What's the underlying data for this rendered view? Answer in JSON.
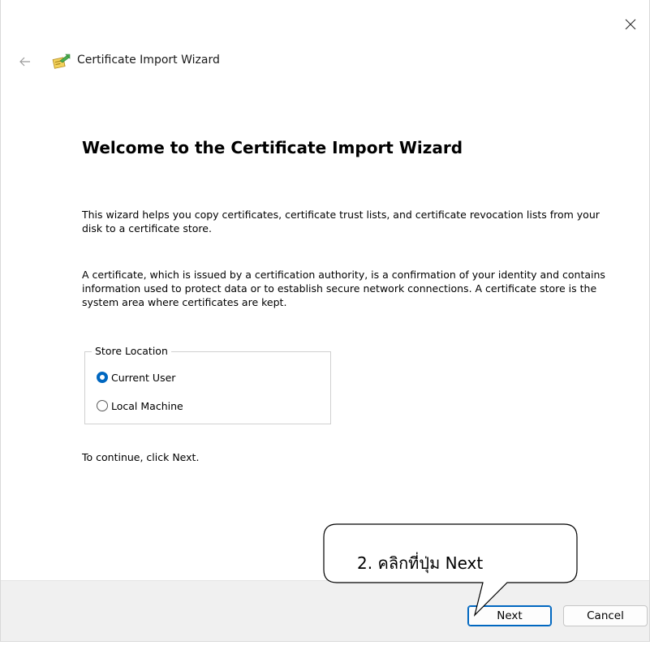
{
  "window": {
    "title": "Certificate Import Wizard",
    "close_icon": "close-icon",
    "back_icon": "back-arrow-icon",
    "title_icon": "certificate-icon"
  },
  "main": {
    "heading": "Welcome to the Certificate Import Wizard",
    "paragraph_1": "This wizard helps you copy certificates, certificate trust lists, and certificate revocation lists from your disk to a certificate store.",
    "paragraph_2": "A certificate, which is issued by a certification authority, is a confirmation of your identity and contains information used to protect data or to establish secure network connections. A certificate store is the system area where certificates are kept.",
    "store_location": {
      "legend": "Store Location",
      "options": [
        {
          "label": "Current User",
          "checked": true
        },
        {
          "label": "Local Machine",
          "checked": false
        }
      ]
    },
    "continue_text": "To continue, click Next."
  },
  "footer": {
    "next_label": "Next",
    "cancel_label": "Cancel"
  },
  "annotation": {
    "callout_text": "2. คลิกที่ปุ่ม Next"
  },
  "colors": {
    "accent": "#0067c0",
    "footer_bg": "#f0f0f0"
  }
}
